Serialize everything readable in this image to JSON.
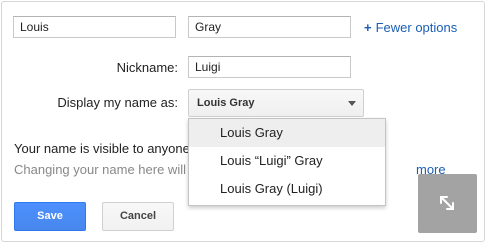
{
  "name_form": {
    "first_name_value": "Louis",
    "last_name_value": "Gray",
    "fewer_options_label": "Fewer options",
    "nickname_label": "Nickname:",
    "nickname_value": "Luigi",
    "display_name_label": "Display my name as:",
    "display_name_selected": "Louis Gray"
  },
  "display_name_options": [
    "Louis Gray",
    "Louis “Luigi” Gray",
    "Louis Gray (Luigi)"
  ],
  "info": {
    "visibility_text": "Your name is visible to anyone",
    "change_text": "Changing your name here will",
    "more_link": "more"
  },
  "buttons": {
    "save_label": "Save",
    "cancel_label": "Cancel"
  },
  "icons": {
    "expand": "expand-arrows-icon",
    "plus": "plus-icon",
    "dropdown_arrow": "caret-down-icon"
  },
  "colors": {
    "link": "#1a5fb4",
    "save_button": "#4d90fe",
    "hover_row": "#eeeeee"
  }
}
